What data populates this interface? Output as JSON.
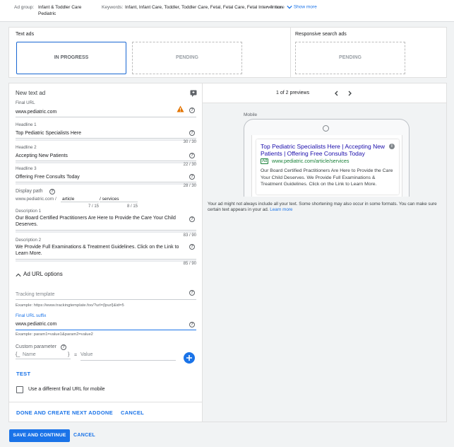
{
  "header": {
    "ad_group_label": "Ad group:",
    "ad_group_line1": "Infant & Toddler Care",
    "ad_group_line2": "Pediatric",
    "keywords_label": "Keywords:",
    "keywords_value": "Infant, Infant Care, Toddler, Toddler Care, Fetal, Fetal Care, Fetal Intervention",
    "more_text": "+ 3 more",
    "show_more": "Show more"
  },
  "text_ads": {
    "title": "Text ads",
    "in_progress": "IN PROGRESS",
    "pending": "PENDING"
  },
  "responsive_ads": {
    "title": "Responsive search ads",
    "pending": "PENDING"
  },
  "form": {
    "title": "New text ad",
    "final_url_label": "Final URL",
    "final_url_value": "www.pediatric.com",
    "headline1_label": "Headline 1",
    "headline1_value": "Top Pediatric Specialists Here",
    "headline1_count": "30 / 30",
    "headline2_label": "Headline 2",
    "headline2_value": "Accepting New Patients",
    "headline2_count": "22 / 30",
    "headline3_label": "Headline 3",
    "headline3_value": "Offering Free Consults Today",
    "headline3_count": "28 / 30",
    "display_path_label": "Display path",
    "display_path_base": "www.pediatric.com /",
    "path1_value": "article",
    "path2_value": "/ services",
    "path1_count": "7 / 15",
    "path2_count": "8 / 15",
    "desc1_label": "Description 1",
    "desc1_value": "Our Board Certified Practitioners Are Here to Provide the Care Your Child Deserves.",
    "desc1_count": "83 / 90",
    "desc2_label": "Description 2",
    "desc2_value": "We Provide Full Examinations & Treatment Guidelines. Click on the Link to Learn More.",
    "desc2_count": "85 / 90",
    "url_options_label": "Ad URL options",
    "tracking_placeholder": "Tracking template",
    "tracking_example": "Example: https://www.trackingtemplate.foo/?url={lpurl}&id=5",
    "suffix_label": "Final URL suffix",
    "suffix_value": "www.pediatric.com",
    "suffix_example": "Example: param1=value1&param2=value2",
    "custom_param_label": "Custom parameter",
    "name_prefix": "{_",
    "name_placeholder": "Name",
    "name_suffix": "}",
    "equals": "=",
    "value_placeholder": "Value",
    "test_label": "TEST",
    "mobile_checkbox_label": "Use a different final URL for mobile"
  },
  "preview": {
    "count_text": "1 of 2 previews",
    "mobile_label": "Mobile",
    "headline": "Top Pediatric Specialists Here | Accepting New Patients | Offering Free Consults Today",
    "ad_badge": "Ad",
    "display_url": "www.pediatric.com/article/services",
    "description": "Our Board Certified Practitioners Are Here to Provide the Care Your Child Deserves. We Provide Full Examinations & Treatment Guidelines. Click on the Link to Learn More.",
    "disclaimer": "Your ad might not always include all your text. Some shortening may also occur in some formats. You can make sure certain text appears in your ad.",
    "learn_more": "Learn more"
  },
  "actions": {
    "done_and_create": "DONE AND CREATE NEXT AD",
    "done": "DONE",
    "cancel": "CANCEL"
  },
  "footer": {
    "save_continue": "SAVE AND CONTINUE",
    "cancel": "CANCEL"
  },
  "colors": {
    "accent": "#1a73e8",
    "warning": "#e37400",
    "ad_green": "#188038"
  }
}
